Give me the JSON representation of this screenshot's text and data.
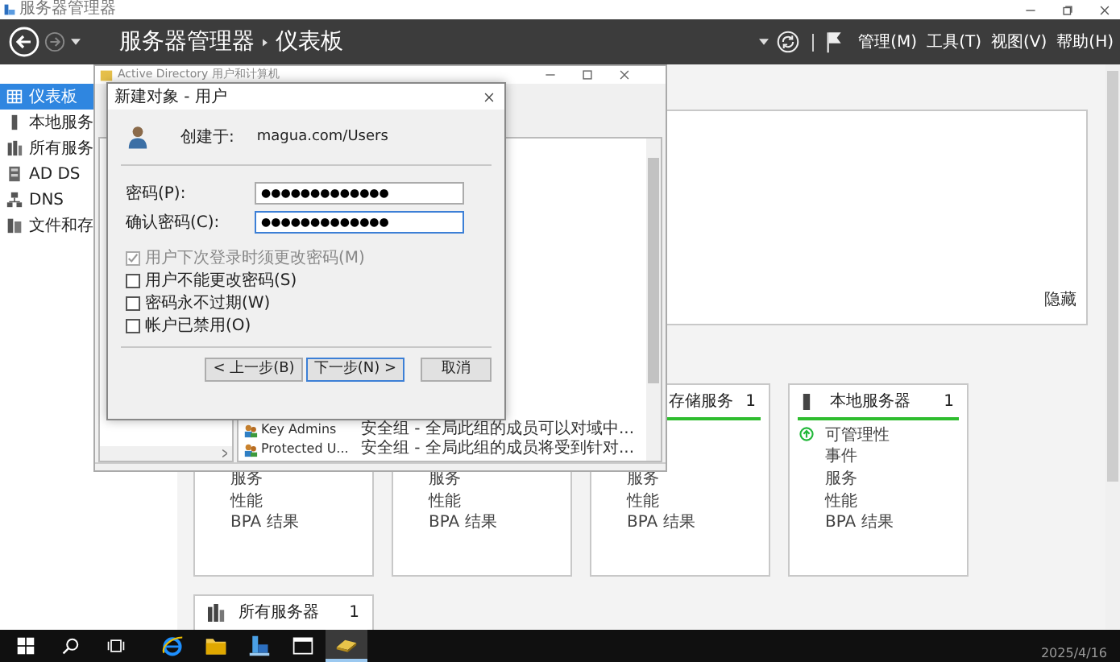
{
  "window": {
    "title": "服务器管理器"
  },
  "header": {
    "breadcrumb": [
      "服务器管理器",
      "仪表板"
    ],
    "menus": [
      "管理(M)",
      "工具(T)",
      "视图(V)",
      "帮助(H)"
    ]
  },
  "sidebar": {
    "items": [
      {
        "label": "仪表板",
        "selected": true,
        "kind": "dashboard"
      },
      {
        "label": "本地服务",
        "selected": false,
        "kind": "server"
      },
      {
        "label": "所有服务",
        "selected": false,
        "kind": "servers"
      },
      {
        "label": "AD DS",
        "selected": false,
        "kind": "adds"
      },
      {
        "label": "DNS",
        "selected": false,
        "kind": "dns"
      },
      {
        "label": "文件和存",
        "selected": false,
        "kind": "files"
      }
    ]
  },
  "welcome": {
    "hide": "隐藏"
  },
  "tiles": [
    {
      "items": [
        {
          "label": "服务",
          "ok": false
        },
        {
          "label": "性能",
          "ok": false
        },
        {
          "label": "BPA 结果",
          "ok": false
        }
      ]
    },
    {
      "items": [
        {
          "label": "服务",
          "ok": false
        },
        {
          "label": "性能",
          "ok": false
        },
        {
          "label": "BPA 结果",
          "ok": false
        }
      ]
    },
    {
      "title": "存储服务",
      "count": "1",
      "icon": false,
      "items": [
        {
          "label": "服务",
          "ok": false
        },
        {
          "label": "性能",
          "ok": false
        },
        {
          "label": "BPA 结果",
          "ok": false
        }
      ]
    },
    {
      "title": "本地服务器",
      "count": "1",
      "icon": true,
      "items": [
        {
          "label": "可管理性",
          "ok": true
        },
        {
          "label": "事件",
          "ok": false
        },
        {
          "label": "服务",
          "ok": false
        },
        {
          "label": "性能",
          "ok": false
        },
        {
          "label": "BPA 结果",
          "ok": false
        }
      ]
    }
  ],
  "tiles_row2": [
    {
      "title": "所有服务器",
      "count": "1",
      "icon": true
    }
  ],
  "ad_window": {
    "title": "Active Directory 用户和计算机",
    "rows": [
      {
        "name": "Key Admins",
        "type": "安全组 - 全局",
        "description": "此组的成员可以对域中..."
      },
      {
        "name": "Protected U...",
        "type": "安全组 - 全局",
        "description": "此组的成员将受到针对..."
      }
    ]
  },
  "dialog": {
    "title": "新建对象 - 用户",
    "created_in_label": "创建于:",
    "created_in": "magua.com/Users",
    "fields": [
      {
        "label": "密码(P):",
        "value": "●●●●●●●●●●●●●",
        "focused": false
      },
      {
        "label": "确认密码(C):",
        "value": "●●●●●●●●●●●●●",
        "focused": true
      }
    ],
    "options": [
      {
        "label": "用户下次登录时须更改密码(M)",
        "checked": true,
        "disabled": true
      },
      {
        "label": "用户不能更改密码(S)",
        "checked": false,
        "disabled": false
      },
      {
        "label": "密码永不过期(W)",
        "checked": false,
        "disabled": false
      },
      {
        "label": "帐户已禁用(O)",
        "checked": false,
        "disabled": false
      }
    ],
    "buttons": [
      {
        "label": "< 上一步(B)",
        "default": false
      },
      {
        "label": "下一步(N) >",
        "default": true
      },
      {
        "label": "取消",
        "default": false
      }
    ]
  },
  "taskbar": {
    "apps": [
      {
        "kind": "ie",
        "selected": false
      },
      {
        "kind": "explorer",
        "selected": false
      },
      {
        "kind": "server-manager",
        "selected": false
      },
      {
        "kind": "console",
        "selected": false
      },
      {
        "kind": "ad-users",
        "selected": true
      }
    ],
    "clock": "2025/4/16"
  }
}
